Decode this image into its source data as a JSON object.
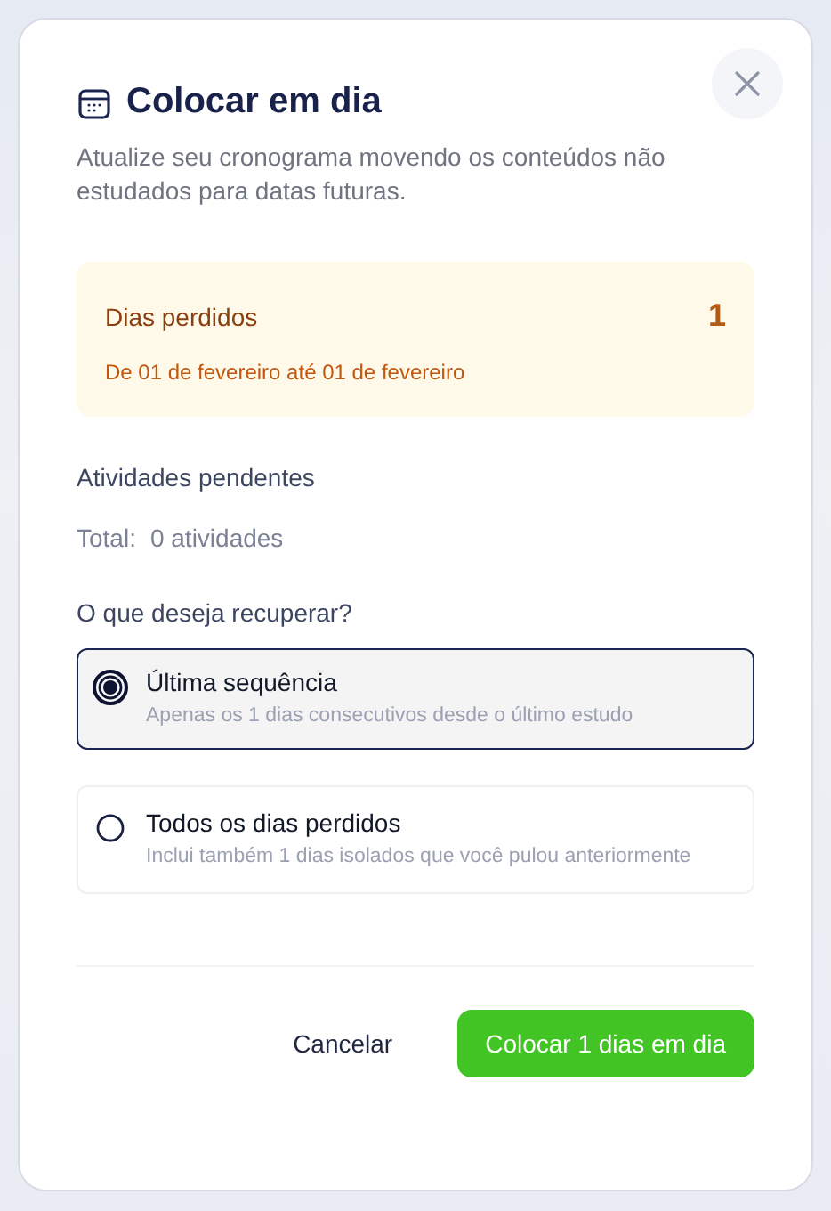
{
  "dialog": {
    "title": "Colocar em dia",
    "description": "Atualize seu cronograma movendo os conteúdos não estudados para datas futuras."
  },
  "missed_days": {
    "label": "Dias perdidos",
    "count": "1",
    "range": "De 01 de fevereiro até 01 de fevereiro"
  },
  "pending": {
    "heading": "Atividades pendentes",
    "total_label": "Total:",
    "total_value": "0 atividades"
  },
  "question": "O que deseja recuperar?",
  "options": [
    {
      "title": "Última sequência",
      "detail": "Apenas os 1 dias consecutivos desde o último estudo",
      "selected": true
    },
    {
      "title": "Todos os dias perdidos",
      "detail": "Inclui também 1 dias isolados que você pulou anteriormente",
      "selected": false
    }
  ],
  "buttons": {
    "cancel": "Cancelar",
    "confirm": "Colocar 1 dias em dia"
  }
}
